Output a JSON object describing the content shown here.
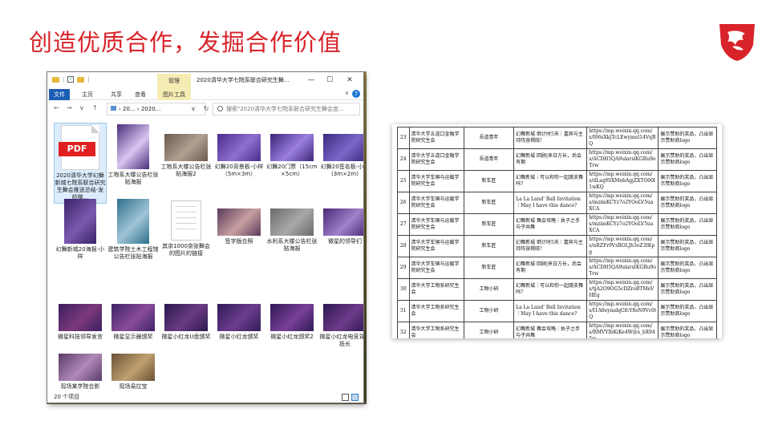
{
  "slide": {
    "title": "创造优质合作，发掘合作价值"
  },
  "explorer": {
    "quick_access_sep": "|",
    "manage_tab": "管理",
    "window_title": "2020清华大学七院系联合研究生舞...",
    "window_buttons": [
      "—",
      "☐",
      "✕"
    ],
    "ribbon_tabs": [
      "文件",
      "主页",
      "共享",
      "查看",
      "图片工具"
    ],
    "ribbon_right": "∨",
    "nav_buttons": [
      "←",
      "→",
      "∨",
      "↑"
    ],
    "address": "› 20... › 2020...",
    "address_dropdown": "∨",
    "refresh": "↻",
    "search_placeholder": "搜索\"2020清华大学七院系联合研究生舞会宣...",
    "items": [
      {
        "label": "2020清华大学幻舞新城七院系联合研究生舞会推送总结-发给微...",
        "kind": "pdf",
        "pdf_text": "PDF",
        "colors": [
          "#e02020"
        ]
      },
      {
        "label": "工物系大楼公告栏张贴海报",
        "kind": "image",
        "colors": [
          "#4a2c7a",
          "#d8c6f0"
        ]
      },
      {
        "label": "工物系大楼公告栏张贴海报2",
        "kind": "image",
        "colors": [
          "#6b5a50",
          "#b0a090"
        ]
      },
      {
        "label": "幻舞20背景板-小样（5m×3m）",
        "kind": "image",
        "colors": [
          "#4a2d8a",
          "#8e6fd0"
        ]
      },
      {
        "label": "幻舞20门票（15cm×5cm）",
        "kind": "image",
        "colors": [
          "#3e2678",
          "#9a7fe0"
        ]
      },
      {
        "label": "幻舞20签名板-小样(3m×2m)",
        "kind": "image",
        "colors": [
          "#3b2a7e",
          "#7b66c8"
        ]
      },
      {
        "label": "幻舞新城20海报-小样",
        "kind": "image",
        "colors": [
          "#3a2366",
          "#7a5ab0"
        ]
      },
      {
        "label": "建筑学院土木工程馆公告栏张贴海报",
        "kind": "image",
        "colors": [
          "#2c6f8a",
          "#a0c4d8"
        ]
      },
      {
        "label": "其余1000余张舞会的图片的链接",
        "kind": "blank",
        "colors": [
          "#ffffff"
        ]
      },
      {
        "label": "签字版合照",
        "kind": "image",
        "colors": [
          "#5a3a5a",
          "#c8a0a0"
        ]
      },
      {
        "label": "水利系大楼公告栏张贴海报",
        "kind": "image",
        "colors": [
          "#6a6a6a",
          "#a8a8a8"
        ]
      },
      {
        "label": "微星的领导们",
        "kind": "image",
        "colors": [
          "#4a2a78",
          "#a080c8"
        ]
      },
      {
        "label": "微星科技领导发言",
        "kind": "image",
        "colors": [
          "#3a1e60",
          "#7c3a7a"
        ]
      },
      {
        "label": "微星显示器颁奖",
        "kind": "image",
        "colors": [
          "#3c2468",
          "#8a4c9a"
        ]
      },
      {
        "label": "微星小红龙U盘颁奖",
        "kind": "image",
        "colors": [
          "#2a1a50",
          "#6a3a80"
        ]
      },
      {
        "label": "微星小红龙颁奖",
        "kind": "image",
        "colors": [
          "#301c58",
          "#6c3c8c"
        ]
      },
      {
        "label": "微星小红龙颁奖2",
        "kind": "image",
        "colors": [
          "#2e1a56",
          "#7a4098"
        ]
      },
      {
        "label": "微星小红龙电竞背包抵长",
        "kind": "image",
        "colors": [
          "#2c1a52",
          "#6e3a8a"
        ]
      },
      {
        "label": "现场某学院合影",
        "kind": "image",
        "colors": [
          "#5a3c6a",
          "#b08ab8"
        ]
      },
      {
        "label": "现场易拉宝",
        "kind": "image",
        "colors": [
          "#6a5236",
          "#c0a070"
        ]
      }
    ],
    "status": "20 个项目"
  },
  "table": {
    "rows": [
      [
        "23",
        "清华大学五道口金融学院研究生会",
        "吾道青年",
        "幻舞新城 倒计时5天｜嘉宾与主持阵容揭晓!",
        "https://mp.weixin.qq.com/s/I96sXkjTcLEwymel14VqBQ",
        "展示赞助的奖品，凸出显示赞助商logo"
      ],
      [
        "24",
        "清华大学五道口金融学院研究生会",
        "吾道青年",
        "幻舞新城 回顾|来日方长，后会有期",
        "https://mp.weixin.qq.com/s/ACDH5QA9ularslKGRu9oTrw",
        "展示赞助的奖品，凸出显示赞助商logo"
      ],
      [
        "25",
        "清华大学车辆与运载学院研究生会",
        "新车匠",
        "幻舞新城｜可以和你一起跳支舞吗?",
        "https://mp.weixin.qq.com/s/dLsq9SXMebAgjZXTO00l1wKQ",
        "展示赞助的奖品，凸出显示赞助商logo"
      ],
      [
        "26",
        "清华大学车辆与运载学院研究生会",
        "新车匠",
        "La La Land' Ball Invitation｜May I have this dance?",
        "https://mp.weixin.qq.com/s/mzimKCYz7o2YOoLV5uaXCA",
        "展示赞助的奖品，凸出显示赞助商logo"
      ],
      [
        "27",
        "清华大学车辆与运载学院研究生会",
        "新车匠",
        "幻舞新城 舞会攻略｜执子之手 与子共舞",
        "https://mp.weixin.qq.com/s/mzimKCYz7o2YOoLV5uaXCA",
        "展示赞助的奖品，凸出显示赞助商logo"
      ],
      [
        "28",
        "清华大学车辆与运载学院研究生会",
        "新车匠",
        "幻舞新城 倒计时5天｜嘉宾与主持阵容揭晓!",
        "https://mp.weixin.qq.com/s/nRZFr9VzROLJh3oZ3IKpg",
        "展示赞助的奖品，凸出显示赞助商logo"
      ],
      [
        "29",
        "清华大学车辆与运载学院研究生会",
        "新车匠",
        "幻舞新城 回顾|来日方长，后会有期",
        "https://mp.weixin.qq.com/s/ACDH5QA9ularsIKGRu9oTrw",
        "展示赞助的奖品，凸出显示赞助商logo"
      ],
      [
        "30",
        "清华大学工物系研究生会",
        "工物小研",
        "幻舞新城｜可以和你一起跳支舞吗?",
        "https://mp.weixin.qq.com/s/tjA2O9OG5cDZroBTMeVHEg",
        "展示赞助的奖品，凸出显示赞助商logo"
      ],
      [
        "31",
        "清华大学工物系研究生会",
        "工物小研",
        "La La Land' Ball Invitation｜May I have this dance?",
        "https://mp.weixin.qq.com/s/I1A8eymdqGfcY8sN9Vc0tQ",
        "展示赞助的奖品，凸出显示赞助商logo"
      ],
      [
        "32",
        "清华大学工物系研究生会",
        "工物小研",
        "幻舞新城 舞会攻略｜执子之手 与子共舞",
        "https://mp.weixin.qq.com/s/RMVYIbKiKe4W@s_bX945w",
        "展示赞助的奖品，凸出显示赞助商logo"
      ],
      [
        "33",
        "清华大学工物系研究生会",
        "工物小研",
        "幻舞新城 倒计时5天｜嘉宾与主持阵容揭晓!",
        "https://mp.weixin.qq.com/s/46xmRFly4DoNxXcNJyrAsw",
        "展示赞助的奖品，凸出显示赞助商logo"
      ]
    ]
  },
  "colors": {
    "title_red": "#d8232a",
    "ribbon_blue": "#1c5fb5",
    "tools_yellow": "#f5ecb4"
  }
}
